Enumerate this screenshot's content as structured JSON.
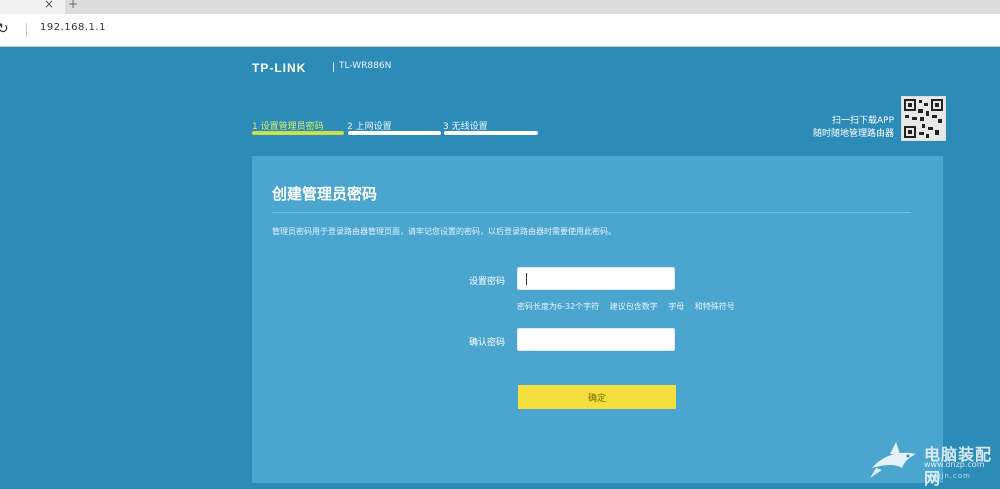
{
  "browser": {
    "tab_close": "×",
    "new_tab": "+",
    "reload": "↻",
    "url": "192.168.1.1"
  },
  "header": {
    "logo": "TP-LINK",
    "model": "TL-WR886N"
  },
  "steps": [
    {
      "label": "1 设置管理员密码",
      "active": true
    },
    {
      "label": "2 上网设置",
      "active": false
    },
    {
      "label": "3 无线设置",
      "active": false
    }
  ],
  "qr": {
    "line1": "扫一扫下载APP",
    "line2": "随时随地管理路由器"
  },
  "panel": {
    "title": "创建管理员密码",
    "description": "管理员密码用于登录路由器管理页面，请牢记您设置的密码，以后登录路由器时需要使用此密码。",
    "password_label": "设置密码",
    "confirm_label": "确认密码",
    "hints": [
      "密码长度为6-32个字符",
      "建议包含数字",
      "字母",
      "和特殊符号"
    ],
    "button": "确定"
  },
  "watermark": {
    "text": "电脑装配网",
    "url": "www.dnzp.com",
    "url2": "xajjn.com"
  },
  "colors": {
    "page_bg": "#2d8bb8",
    "panel_bg": "#4aa5cf",
    "button_bg": "#f4df3e",
    "active_step": "#c8e04a"
  }
}
